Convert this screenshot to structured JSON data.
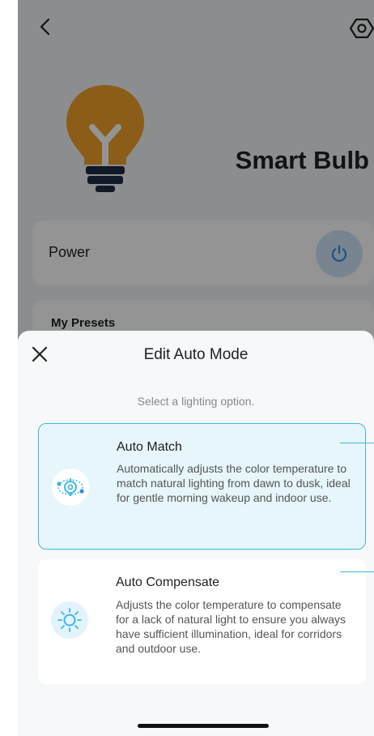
{
  "device": {
    "name": "Smart Bulb"
  },
  "power": {
    "label": "Power"
  },
  "presets": {
    "label": "My Presets"
  },
  "sheet": {
    "title": "Edit Auto Mode",
    "subtitle": "Select a lighting option.",
    "options": [
      {
        "title": "Auto Match",
        "description": "Automatically adjusts the color temperature to match natural lighting from dawn to dusk, ideal for gentle morning wakeup and indoor use.",
        "selected": true,
        "icon": "auto-match-icon"
      },
      {
        "title": "Auto Compensate",
        "description": "Adjusts the color temperature to compensate for a lack of natural light to ensure you always have sufficient illumination, ideal for corridors and outdoor use.",
        "selected": false,
        "icon": "sun-icon"
      }
    ]
  },
  "colors": {
    "accent": "#3db8e0",
    "selected_bg": "#e6f6fa",
    "bulb": "#f0a12a",
    "power_icon": "#2f8fe0"
  }
}
